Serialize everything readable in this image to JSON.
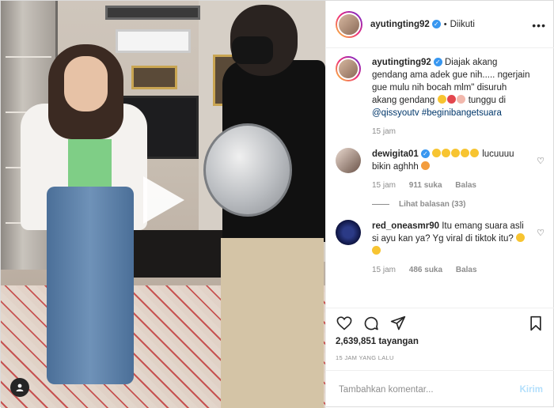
{
  "header": {
    "username": "ayutingting92",
    "follow_status": "Diikuti",
    "separator": "•"
  },
  "caption": {
    "username": "ayutingting92",
    "text": "Diajak akang gendang ama adek gue nih..... ngerjain gue mulu nih bocah mlm\" disuruh akang gendang",
    "text_after_emojis": "tunggu di",
    "mention": "@qissyoutv",
    "hashtag": "#beginibangetsuara",
    "time": "15 jam"
  },
  "comments": [
    {
      "username": "dewigita01",
      "text": "lucuuuu bikin aghhh",
      "time": "15 jam",
      "likes": "911 suka",
      "reply": "Balas",
      "view_replies": "Lihat balasan (33)"
    },
    {
      "username": "red_oneasmr90",
      "text": "Itu emang suara asli si ayu kan ya? Yg viral di tiktok itu?",
      "time": "15 jam",
      "likes": "486 suka",
      "reply": "Balas"
    }
  ],
  "stats": {
    "views": "2,639,851 tayangan",
    "posted": "15 JAM YANG LALU"
  },
  "add_comment": {
    "placeholder": "Tambahkan komentar...",
    "send_label": "Kirim"
  },
  "icons": {
    "more": "more-options-icon",
    "like": "heart-icon",
    "comment": "comment-icon",
    "share": "send-icon",
    "save": "bookmark-icon",
    "play": "play-icon",
    "mute": "user-tag-icon"
  },
  "colors": {
    "verified": "#3897f0",
    "link": "#00376b",
    "muted": "#8e8e8e",
    "send_disabled": "#b2dffc"
  }
}
